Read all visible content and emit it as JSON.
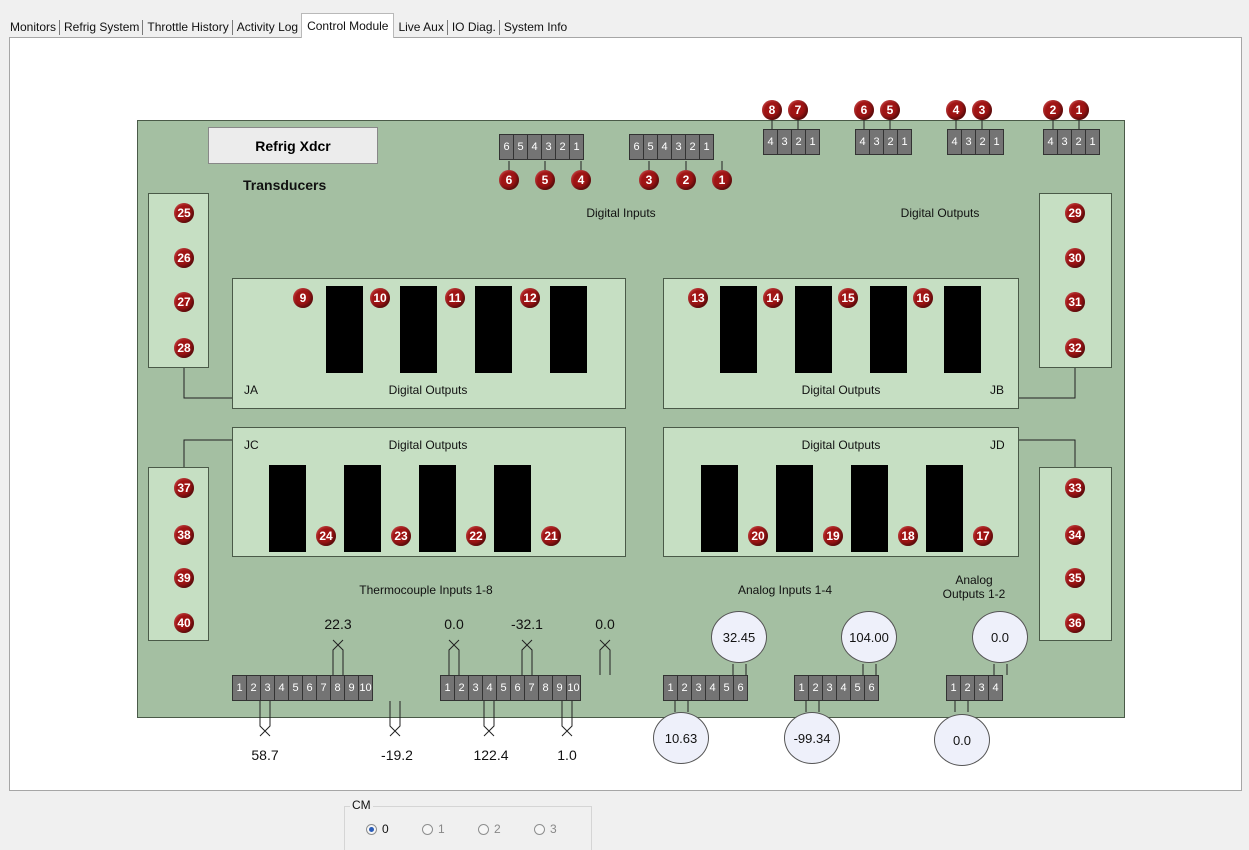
{
  "tabs": [
    {
      "label": "Monitors"
    },
    {
      "label": "Refrig System"
    },
    {
      "label": "Throttle History"
    },
    {
      "label": "Activity Log"
    },
    {
      "label": "Control Module",
      "active": true
    },
    {
      "label": "Live Aux"
    },
    {
      "label": "IO Diag."
    },
    {
      "label": "System Info"
    }
  ],
  "board": {
    "title_button": "Refrig Xdcr",
    "transducers_label": "Transducers",
    "digital_inputs_label": "Digital Inputs",
    "digital_outputs_label": "Digital Outputs",
    "panel_labels": {
      "ja": "JA",
      "jb": "JB",
      "jc": "JC",
      "jd": "JD"
    },
    "panel_title": "Digital Outputs",
    "thermocouple_label": "Thermocouple Inputs 1-8",
    "analog_inputs_label": "Analog Inputs 1-4",
    "analog_outputs_label_1": "Analog",
    "analog_outputs_label_2": "Outputs 1-2"
  },
  "connectors": {
    "din_a": [
      "6",
      "5",
      "4",
      "3",
      "2",
      "1"
    ],
    "din_b": [
      "6",
      "5",
      "4",
      "3",
      "2",
      "1"
    ],
    "dout": [
      "4",
      "3",
      "2",
      "1"
    ],
    "tc": [
      "1",
      "2",
      "3",
      "4",
      "5",
      "6",
      "7",
      "8",
      "9",
      "10"
    ],
    "ai": [
      "1",
      "2",
      "3",
      "4",
      "5",
      "6"
    ],
    "ao": [
      "1",
      "2",
      "3",
      "4"
    ]
  },
  "pins": {
    "din_a": [
      "6",
      "5",
      "4"
    ],
    "din_b": [
      "3",
      "2",
      "1"
    ],
    "dout": [
      "8",
      "7",
      "6",
      "5",
      "4",
      "3",
      "2",
      "1"
    ],
    "left_top": [
      "25",
      "26",
      "27",
      "28"
    ],
    "right_top": [
      "29",
      "30",
      "31",
      "32"
    ],
    "left_bottom": [
      "37",
      "38",
      "39",
      "40"
    ],
    "right_bottom": [
      "33",
      "34",
      "35",
      "36"
    ],
    "ja": [
      "9",
      "10",
      "11",
      "12"
    ],
    "jb": [
      "13",
      "14",
      "15",
      "16"
    ],
    "jc": [
      "24",
      "23",
      "22",
      "21"
    ],
    "jd": [
      "20",
      "19",
      "18",
      "17"
    ]
  },
  "thermocouple_values": {
    "tc_top_1": "22.3",
    "tc_top_2": "0.0",
    "tc_top_3": "-32.1",
    "tc_top_4": "0.0",
    "tc_bot_1": "58.7",
    "tc_bot_2": "-19.2",
    "tc_bot_3": "122.4",
    "tc_bot_4": "1.0"
  },
  "analog_values": {
    "ai_1_top": "32.45",
    "ai_1_bot": "10.63",
    "ai_2_top": "104.00",
    "ai_2_bot": "-99.34",
    "ao_top": "0.0",
    "ao_bot": "0.0"
  },
  "cm_group": {
    "legend": "CM",
    "options": [
      {
        "label": "0",
        "selected": true
      },
      {
        "label": "1"
      },
      {
        "label": "2"
      },
      {
        "label": "3"
      }
    ]
  },
  "colors": {
    "board": "#a4bfa2",
    "panel": "#c6dfc3",
    "pin": "#a01414",
    "connector": "#747474"
  }
}
